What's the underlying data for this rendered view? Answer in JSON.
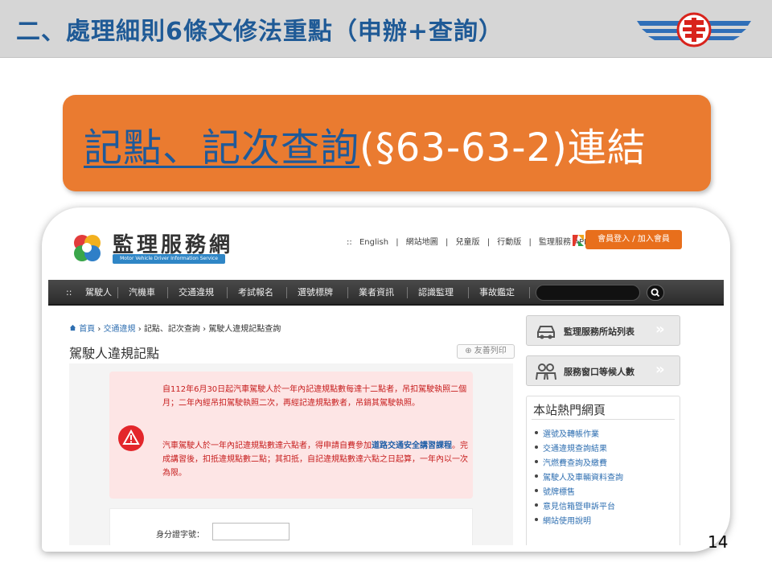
{
  "slide": {
    "title": "二、處理細則6條文修法重點（申辦+查詢）",
    "banner_link": "記點、記次查詢",
    "banner_suffix": "(§63-63-2)連結",
    "page_number": "14"
  },
  "site": {
    "logo_text": "監理服務網",
    "logo_sub": "Motor Vehicle Driver Information Service",
    "top_links": [
      "::",
      "English",
      "|",
      "網站地圖",
      "|",
      "兒童版",
      "|",
      "行動版",
      "|",
      "監理服務 APP"
    ],
    "login": "會員登入 / 加入會員",
    "nav": [
      "::",
      "駕駛人",
      "汽機車",
      "交通違規",
      "考試報名",
      "選號標牌",
      "業者資訊",
      "認識監理",
      "事故鑑定"
    ],
    "breadcrumb": {
      "home": "首頁",
      "sep": "›",
      "l1": "交通違規",
      "l2": "記點、記次查詢",
      "l3": "駕駛人違規記點查詢"
    },
    "heading": "駕駛人違規記點",
    "print": "友善列印",
    "alert": {
      "p1": "自112年6月30日起汽車駕駛人於一年內記違規點數每達十二點者，吊扣駕駛執照二個月；二年內經吊扣駕駛執照二次，再經記違規點數者，吊銷其駕駛執照。",
      "p2_pre": "汽車駕駛人於一年內記違規點數達六點者，得申請自費參加",
      "p2_link": "道路交通安全講習課程",
      "p2_post": "。完成講習後，扣抵違規點數二點；其扣抵，自記違規點數達六點之日起算，一年內以一次為限。"
    },
    "id_label": "身分證字號：",
    "side_buttons": [
      "監理服務所站列表",
      "服務窗口等候人數"
    ],
    "hot_title": "本站熱門網頁",
    "hot_items": [
      "選號及轉帳作業",
      "交通違規查詢結果",
      "汽燃費查詢及繳費",
      "駕駛人及車輛資料查詢",
      "號牌標售",
      "意見信箱暨申訴平台",
      "網站使用說明"
    ]
  }
}
